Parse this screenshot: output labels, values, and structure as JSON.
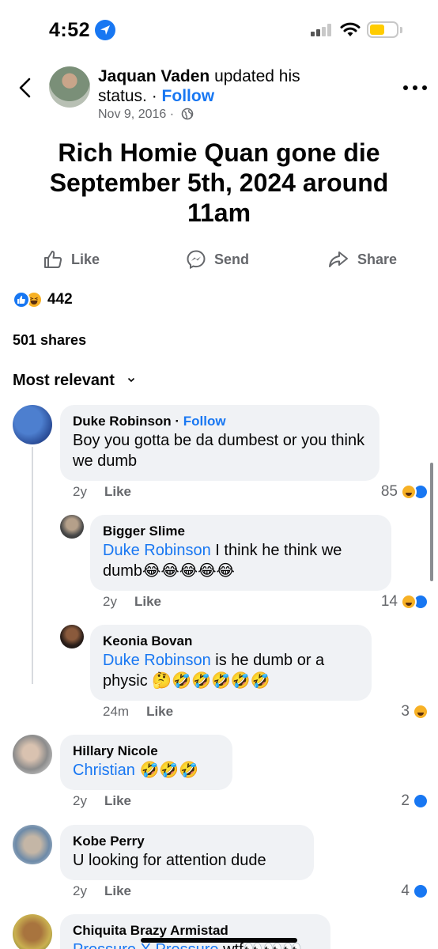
{
  "status_bar": {
    "time": "4:52",
    "colors": {
      "battery": "#ffcc00",
      "location": "#1877f2"
    }
  },
  "post": {
    "author": "Jaquan Vaden",
    "action_text": "updated his status.",
    "separator": " · ",
    "follow": "Follow",
    "date": "Nov 9, 2016",
    "meta_separator": " · ",
    "privacy_icon": "globe-icon",
    "status": "Rich Homie Quan gone die September 5th, 2024 around 11am",
    "actions": {
      "like": "Like",
      "send": "Send",
      "share": "Share"
    },
    "reaction_count": "442",
    "shares": "501 shares",
    "sort_label": "Most relevant"
  },
  "comments": [
    {
      "name": "Duke Robinson",
      "follow": "Follow",
      "text": "Boy you gotta be da dumbest or you think we dumb",
      "age": "2y",
      "like": "Like",
      "reactions": "85"
    },
    {
      "name": "Bigger Slime",
      "mention": "Duke Robinson",
      "text": " I think he think we dumb😂😂😂😂😂",
      "age": "2y",
      "like": "Like",
      "reactions": "14"
    },
    {
      "name": "Keonia Bovan",
      "mention": "Duke Robinson",
      "text": "  is he dumb or a physic 🤔🤣🤣🤣🤣🤣",
      "age": "24m",
      "like": "Like",
      "reactions": "3"
    },
    {
      "name": "Hillary Nicole",
      "mention": "Christian",
      "text": " 🤣🤣🤣",
      "age": "2y",
      "like": "Like",
      "reactions": "2"
    },
    {
      "name": "Kobe Perry",
      "text": "U looking for attention dude",
      "age": "2y",
      "like": "Like",
      "reactions": "4"
    },
    {
      "name": "Chiquita Brazy Armistad",
      "mention": "Pressure X Pressure",
      "text": " wtf👀👀👀"
    }
  ]
}
